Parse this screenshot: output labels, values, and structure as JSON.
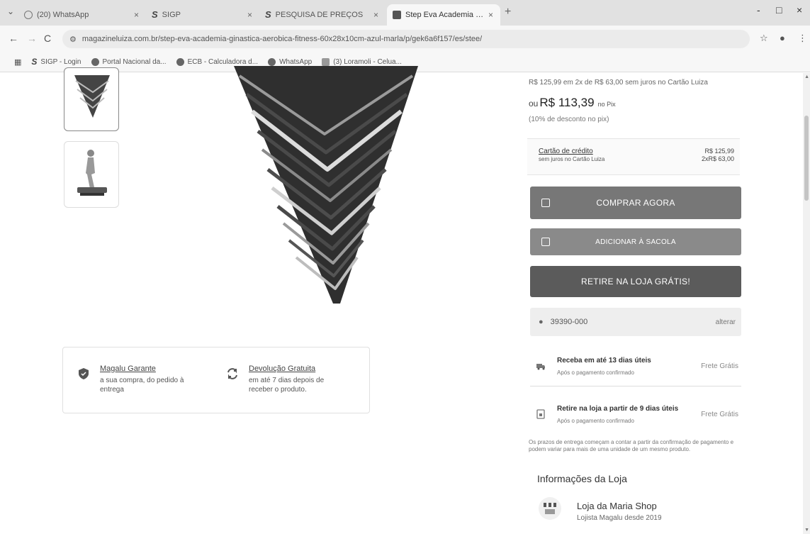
{
  "browser": {
    "tabs_menu_icon": "chevron-down-icon",
    "tabs": [
      {
        "title": "(20) WhatsApp",
        "favicon": "whatsapp-icon",
        "active": false
      },
      {
        "title": "SIGP",
        "favicon": "sigp-icon",
        "active": false
      },
      {
        "title": "PESQUISA DE PREÇOS",
        "favicon": "sigp-icon",
        "active": false
      },
      {
        "title": "Step Eva Academia Ginastica A",
        "favicon": "magalu-icon",
        "active": true
      }
    ],
    "new_tab_symbol": "+",
    "window_controls": {
      "minimize": "-",
      "maximize": "□",
      "close": "×"
    },
    "nav": {
      "back": "←",
      "forward": "→",
      "reload": "C"
    },
    "url": "magazineluiza.com.br/step-eva-academia-ginastica-aerobica-fitness-60x28x10cm-azul-marla/p/gek6a6f157/es/stee/",
    "bookmarks": [
      {
        "label": "SIGP - Login",
        "icon": "sigp-icon"
      },
      {
        "label": "Portal Nacional da...",
        "icon": "globe-icon"
      },
      {
        "label": "ECB - Calculadora d...",
        "icon": "globe-icon"
      },
      {
        "label": "WhatsApp",
        "icon": "whatsapp-icon"
      },
      {
        "label": "(3) Loramoli - Celua...",
        "icon": "bookmark-icon"
      }
    ]
  },
  "product": {
    "installments_text": "R$ 125,99 em 2x de R$ 63,00 sem juros no Cartão Luiza",
    "pix_prefix": "ou",
    "pix_price": "R$ 113,39",
    "pix_label": "no Pix",
    "discount_text": "(10% de desconto no pix)",
    "card": {
      "title": "Cartão de crédito",
      "subtitle": "sem juros no Cartão Luiza",
      "total": "R$ 125,99",
      "installments": "2xR$ 63,00"
    },
    "buttons": {
      "buy_now": "COMPRAR AGORA",
      "add_to_bag": "ADICIONAR À SACOLA",
      "pickup_store": "RETIRE NA LOJA GRÁTIS!"
    },
    "cep": {
      "value": "39390-000",
      "change_label": "alterar"
    },
    "shipping": [
      {
        "title": "Receba em até 13 dias úteis",
        "subtitle": "Após o pagamento confirmado",
        "price": "Frete Grátis"
      },
      {
        "title": "Retire na loja a partir de 9 dias úteis",
        "subtitle": "Após o pagamento confirmado",
        "price": "Frete Grátis"
      }
    ],
    "disclaimer": "Os prazos de entrega começam a contar a partir da confirmação de pagamento e podem variar para mais de uma unidade de um mesmo produto."
  },
  "guarantees": [
    {
      "title": "Magalu Garante",
      "text": "a sua compra, do pedido à entrega",
      "icon": "shield-icon"
    },
    {
      "title": "Devolução Gratuita",
      "text": "em até 7 dias depois de receber o produto.",
      "icon": "return-arrows-icon"
    }
  ],
  "store": {
    "heading": "Informações da Loja",
    "name": "Loja da Maria Shop",
    "since": "Lojista Magalu desde 2019",
    "icon": "store-icon"
  }
}
